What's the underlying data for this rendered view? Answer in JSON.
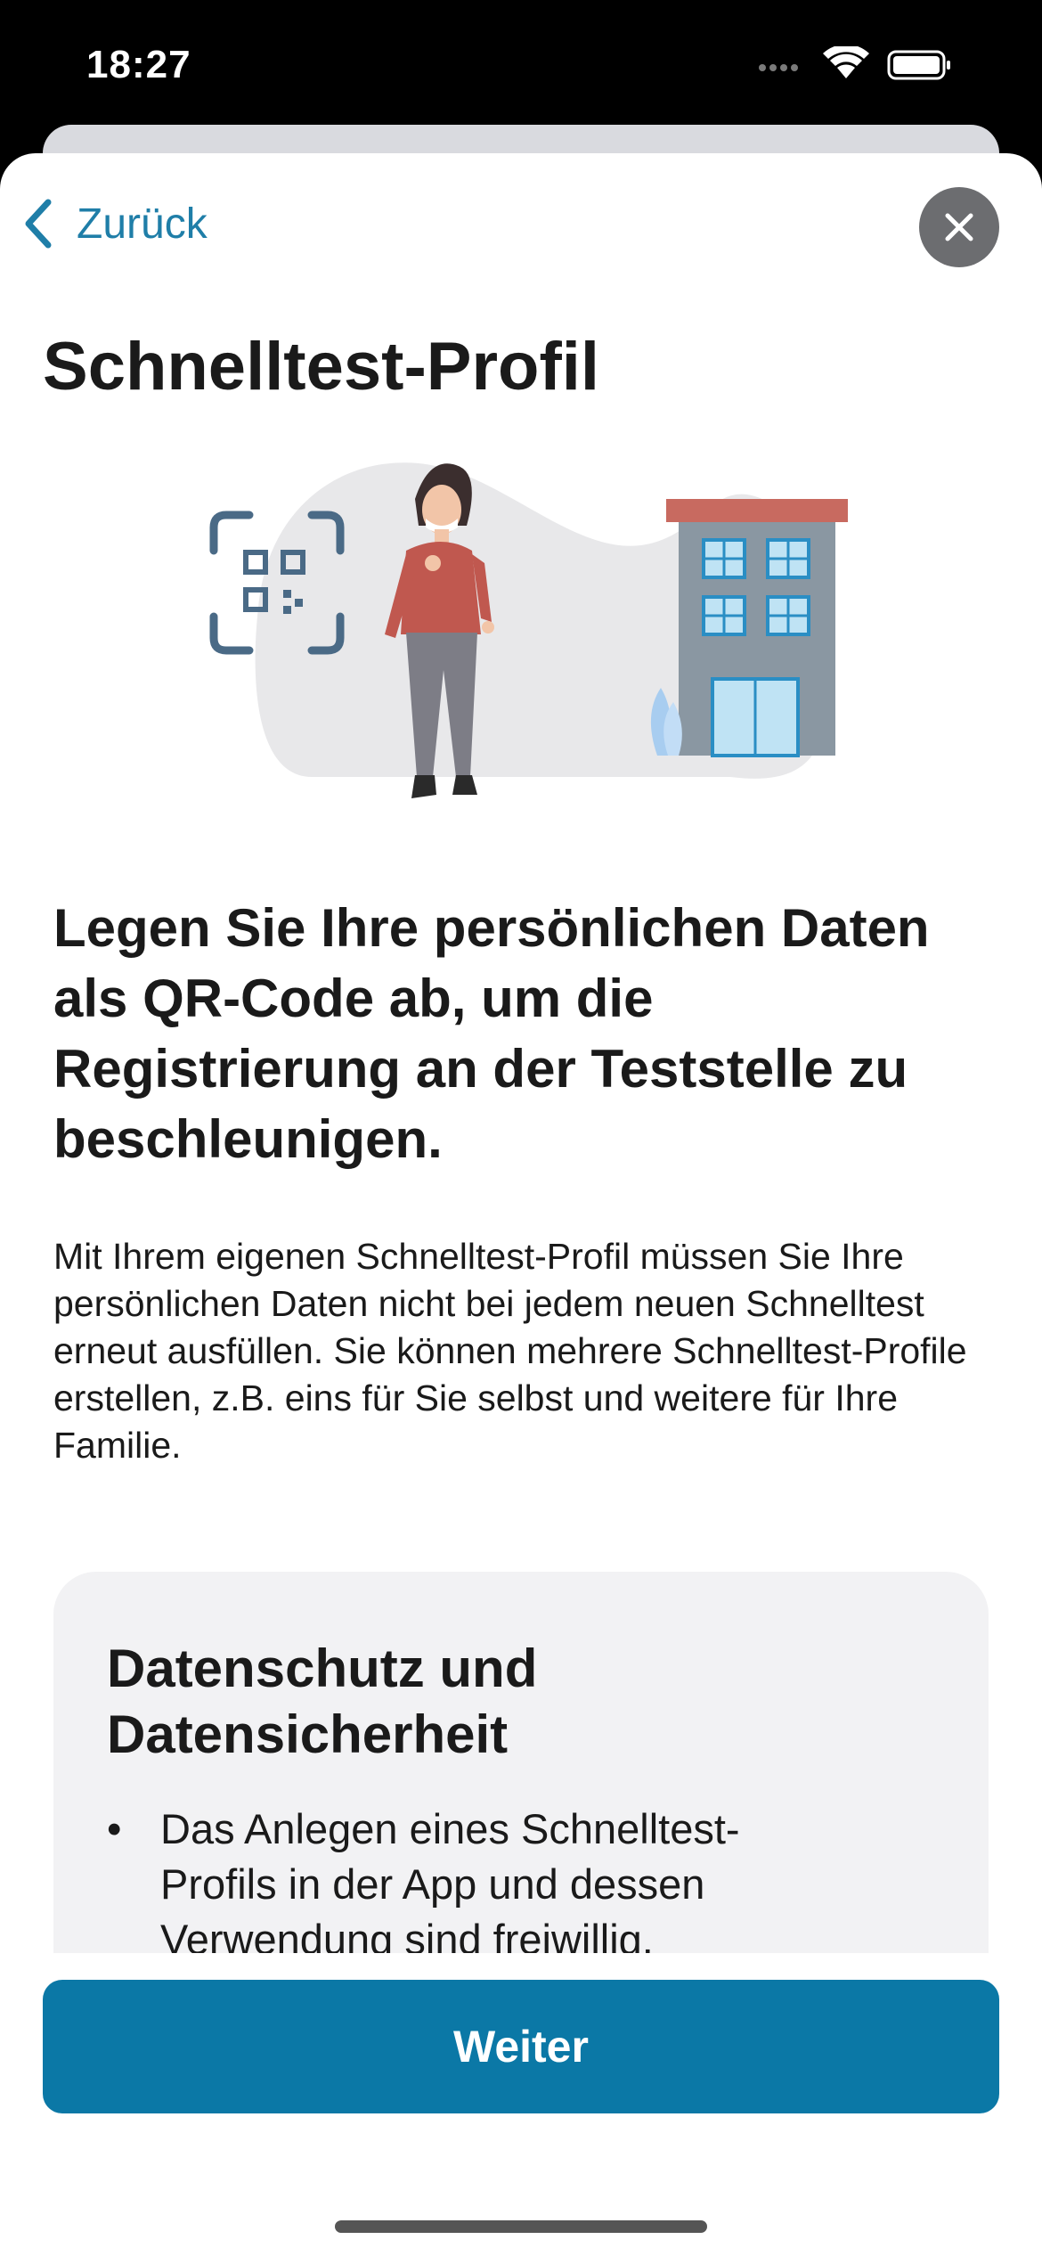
{
  "status_bar": {
    "time": "18:27",
    "icons": [
      "signal-dots-icon",
      "wifi-icon",
      "battery-icon"
    ]
  },
  "nav": {
    "back_label": "Zurück",
    "close_icon": "close-icon"
  },
  "page": {
    "title": "Schnelltest-Profil",
    "illustration": "woman-with-qr-code-and-test-center-illustration",
    "headline": "Legen Sie Ihre persönlichen Daten als QR-Code ab, um die Registrierung an der Teststelle zu beschleunigen.",
    "body": "Mit Ihrem eigenen Schnelltest-Profil müssen Sie Ihre persönlichen Daten nicht bei jedem neuen Schnelltest erneut ausfüllen. Sie können mehrere Schnelltest-Profile erstellen, z.B. eins für Sie selbst und weitere für Ihre Familie."
  },
  "privacy": {
    "title": "Datenschutz und Datensicherheit",
    "items": [
      "Das Anlegen eines Schnelltest-Profils in der App und dessen Verwendung sind freiwillig."
    ]
  },
  "footer": {
    "button_label": "Weiter"
  },
  "colors": {
    "accent": "#0b78a6",
    "link": "#1f7ea8"
  }
}
